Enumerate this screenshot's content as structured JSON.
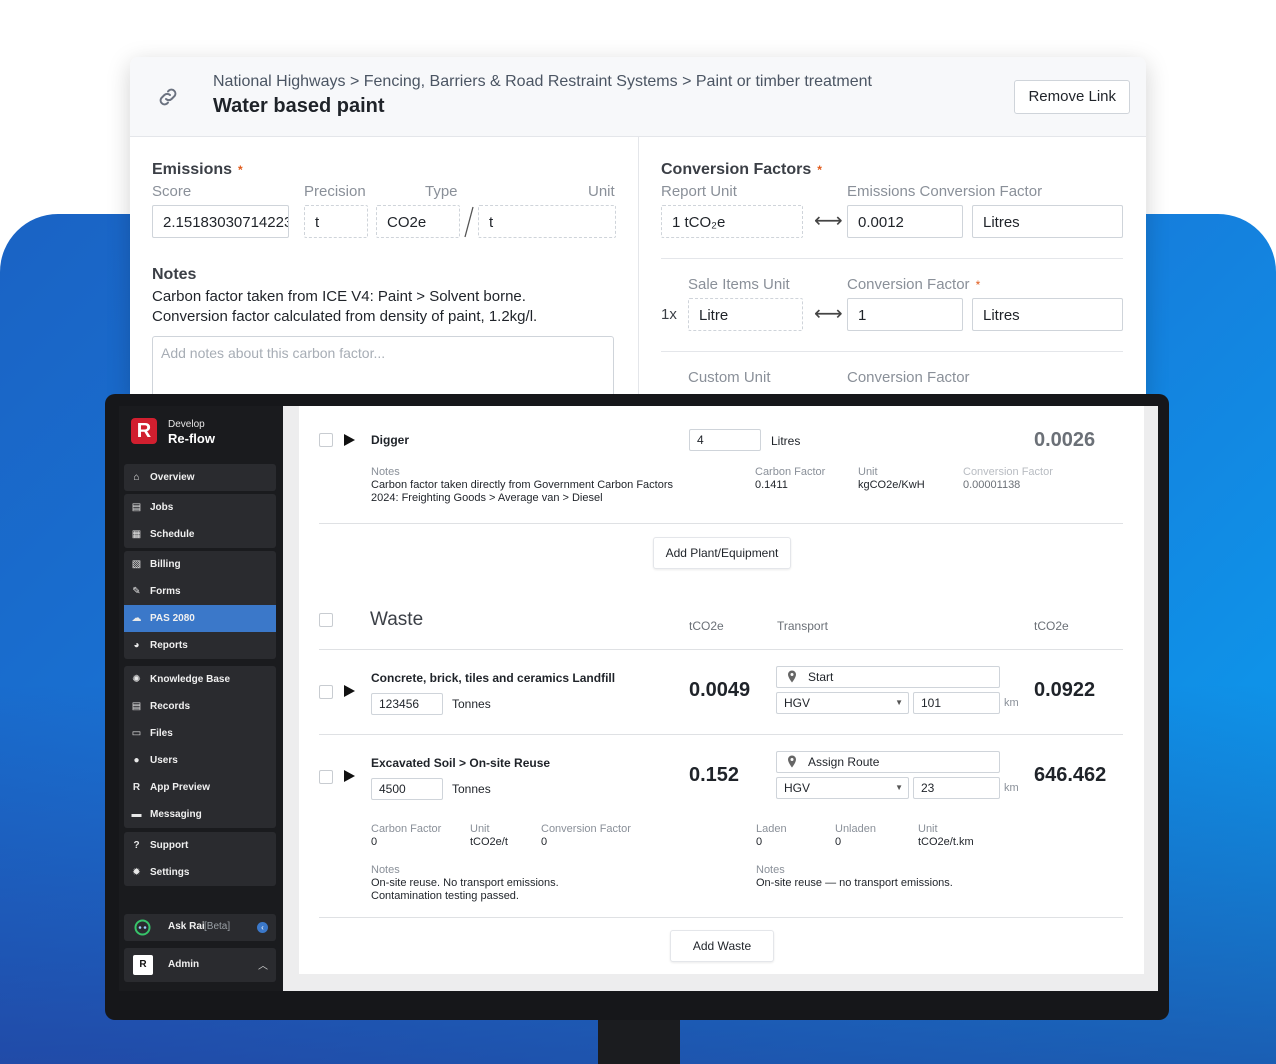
{
  "link_panel": {
    "breadcrumb": "National Highways > Fencing, Barriers & Road Restraint Systems > Paint or timber treatment",
    "title": "Water based paint",
    "remove_link": "Remove Link",
    "emissions": {
      "heading": "Emissions",
      "required_mark": "*",
      "score_label": "Score",
      "precision_label": "Precision",
      "type_label": "Type",
      "unit_label": "Unit",
      "score_value": "2.15183030714223",
      "precision_value": "t",
      "type_value": "CO2e",
      "unit_value": "t"
    },
    "notes": {
      "heading": "Notes",
      "line1": "Carbon factor taken from ICE V4: Paint > Solvent borne.",
      "line2": "Conversion factor calculated from density of paint, 1.2kg/l.",
      "placeholder": "Add notes about this carbon factor..."
    },
    "conversion": {
      "heading": "Conversion Factors",
      "required_mark": "*",
      "report_unit_label": "Report Unit",
      "ecf_label": "Emissions Conversion Factor",
      "report_unit_value": "1 tCO₂e",
      "ecf_value": "0.0012",
      "ecf_unit": "Litres",
      "sale_items_label": "Sale Items Unit",
      "cf_label": "Conversion Factor",
      "multiplier": "1x",
      "sale_unit_value": "Litre",
      "cf_value": "1",
      "cf_unit": "Litres",
      "custom_unit_label": "Custom Unit",
      "custom_cf_label": "Conversion Factor"
    }
  },
  "app": {
    "brand_top": "Develop",
    "brand_bottom": "Re-flow",
    "logo_letter": "R",
    "nav_groups": [
      [
        {
          "label": "Overview",
          "icon": "home-icon",
          "glyph": "⌂"
        }
      ],
      [
        {
          "label": "Jobs",
          "icon": "jobs-icon",
          "glyph": "▤"
        },
        {
          "label": "Schedule",
          "icon": "calendar-icon",
          "glyph": "▦"
        }
      ],
      [
        {
          "label": "Billing",
          "icon": "billing-icon",
          "glyph": "▧"
        },
        {
          "label": "Forms",
          "icon": "forms-icon",
          "glyph": "✎"
        },
        {
          "label": "PAS 2080",
          "icon": "cloud-icon",
          "glyph": "☁"
        },
        {
          "label": "Reports",
          "icon": "pie-chart-icon",
          "glyph": "◕"
        }
      ],
      [
        {
          "label": "Knowledge Base",
          "icon": "lightbulb-icon",
          "glyph": "✺"
        },
        {
          "label": "Records",
          "icon": "records-icon",
          "glyph": "▤"
        },
        {
          "label": "Files",
          "icon": "files-icon",
          "glyph": "▭"
        },
        {
          "label": "Users",
          "icon": "user-icon",
          "glyph": "●"
        },
        {
          "label": "App Preview",
          "icon": "app-preview-icon",
          "glyph": "R"
        },
        {
          "label": "Messaging",
          "icon": "chat-icon",
          "glyph": "▬"
        }
      ],
      [
        {
          "label": "Support",
          "icon": "help-icon",
          "glyph": "?"
        },
        {
          "label": "Settings",
          "icon": "gear-icon",
          "glyph": "✹"
        }
      ]
    ],
    "active_nav": "PAS 2080",
    "ask_label": "Ask Rai",
    "ask_beta": "[Beta]",
    "admin_letter": "R",
    "admin_label": "Admin"
  },
  "plant": {
    "name": "Digger",
    "qty": "4",
    "unit": "Litres",
    "total": "0.0026",
    "notes_label": "Notes",
    "notes_line1": "Carbon factor taken directly from Government Carbon Factors",
    "notes_line2": "2024: Freighting Goods > Average van > Diesel",
    "cf_label": "Carbon Factor",
    "cf_value": "0.1411",
    "unit_label": "Unit",
    "unit_value": "kgCO2e/KwH",
    "conv_label": "Conversion Factor",
    "conv_value": "0.00001138",
    "add_button": "Add Plant/Equipment"
  },
  "waste": {
    "heading": "Waste",
    "col_tco2e": "tCO2e",
    "col_transport": "Transport",
    "col_tco2e_2": "tCO2e",
    "rows": [
      {
        "name": "Concrete, brick, tiles and ceramics Landfill",
        "qty": "123456",
        "unit": "Tonnes",
        "tco2e": "0.0049",
        "route": "Start",
        "vehicle": "HGV",
        "distance": "101",
        "km": "km",
        "transport_tco2e": "0.0922"
      },
      {
        "name": "Excavated Soil > On-site Reuse",
        "qty": "4500",
        "unit": "Tonnes",
        "tco2e": "0.152",
        "route": "Assign Route",
        "vehicle": "HGV",
        "distance": "23",
        "km": "km",
        "transport_tco2e": "646.462"
      }
    ],
    "detail": {
      "cf_label": "Carbon Factor",
      "cf_value": "0",
      "unit_label": "Unit",
      "unit_value": "tCO2e/t",
      "conv_label": "Conversion Factor",
      "conv_value": "0",
      "laden_label": "Laden",
      "laden_value": "0",
      "unladen_label": "Unladen",
      "unladen_value": "0",
      "unit2_label": "Unit",
      "unit2_value": "tCO2e/t.km",
      "notes_label": "Notes",
      "notes_line1": "On-site reuse. No transport emissions.",
      "notes_line2": "Contamination testing passed.",
      "notes2_label": "Notes",
      "notes2_line1": "On-site reuse — no transport emissions."
    },
    "add_button": "Add Waste"
  },
  "colors": {
    "accent": "#3b78c9",
    "brand_red": "#d11f2f",
    "required": "#e05a1b"
  }
}
